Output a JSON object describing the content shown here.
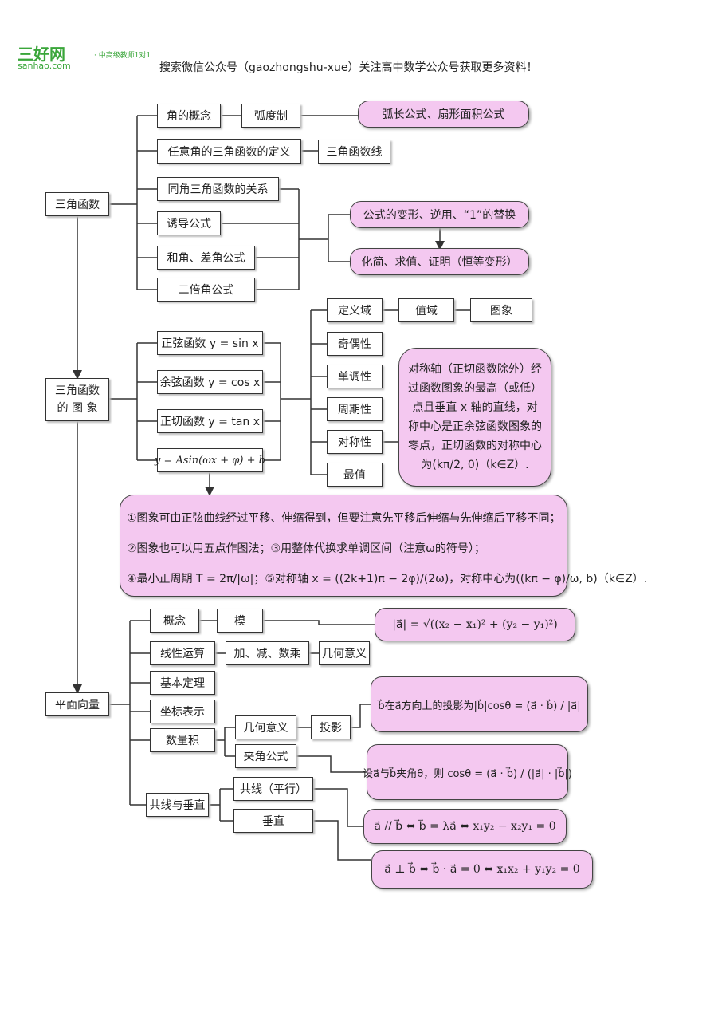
{
  "logo": {
    "brand": "三好网",
    "domain": "sanhao.com",
    "tagline": "· 中高级教师1对1"
  },
  "header": {
    "text": "搜索微信公众号（gaozhongshu-xue）关注高中数学公众号获取更多资料！"
  },
  "colors": {
    "highlight": "#f4c8f0",
    "line": "#333333",
    "logo": "#3aa63a"
  },
  "trig": {
    "root": "三角函数",
    "angle_concept": "角的概念",
    "radian": "弧度制",
    "arc_formula": "弧长公式、扇形面积公式",
    "any_angle_def": "任意角的三角函数的定义",
    "trig_line": "三角函数线",
    "same_angle": "同角三角函数的关系",
    "induction": "诱导公式",
    "sum_diff": "和角、差角公式",
    "double_angle": "二倍角公式",
    "transform": "公式的变形、逆用、“1”的替换",
    "simplify": "化简、求值、证明（恒等变形）"
  },
  "graph": {
    "root": "三角函数的 图 象",
    "sin": "正弦函数 y = sin x",
    "cos": "余弦函数 y = cos x",
    "tan": "正切函数 y = tan x",
    "general": "y = Asin(ωx + φ) + b",
    "domain": "定义域",
    "range": "值域",
    "image": "图象",
    "parity": "奇偶性",
    "monotonic": "单调性",
    "period": "周期性",
    "symmetry": "对称性",
    "extreme": "最值",
    "symmetry_note": "对称轴（正切函数除外）经过函数图象的最高（或低）点且垂直 x 轴的直线，对称中心是正余弦函数图象的零点，正切函数的对称中心为(kπ/2, 0)（k∈Z）.",
    "notes": [
      "①图象可由正弦曲线经过平移、伸缩得到，但要注意先平移后伸缩与先伸缩后平移不同；",
      "②图象也可以用五点作图法；③用整体代换求单调区间（注意ω的符号）；",
      "④最小正周期 T = 2π/|ω|；⑤对称轴 x = ((2k+1)π − 2φ)/(2ω)，对称中心为((kπ − φ)/ω, b)（k∈Z）."
    ]
  },
  "vector": {
    "root": "平面向量",
    "concept": "概念",
    "modulus": "模",
    "modulus_formula": "|a⃗| = √((x₂ − x₁)² + (y₂ − y₁)²)",
    "linear": "线性运算",
    "add_sub_mul": "加、减、数乘",
    "geo_meaning1": "几何意义",
    "basic_theorem": "基本定理",
    "coordinates": "坐标表示",
    "dot_product": "数量积",
    "geo_meaning2": "几何意义",
    "projection": "投影",
    "projection_formula": "b⃗在a⃗方向上的投影为|b⃗|cosθ = (a⃗ · b⃗) / |a⃗|",
    "angle_formula": "夹角公式",
    "angle_formula_text": "设a⃗与b⃗夹角θ，则 cosθ = (a⃗ · b⃗) / (|a⃗| · |b⃗|)",
    "collinear_perp": "共线与垂直",
    "collinear": "共线（平行）",
    "collinear_formula": "a⃗ // b⃗ ⇔ b⃗ = λa⃗ ⇔ x₁y₂ − x₂y₁ = 0",
    "perpendicular": "垂直",
    "perp_formula": "a⃗ ⊥ b⃗ ⇔ b⃗ · a⃗ = 0 ⇔ x₁x₂ + y₁y₂ = 0"
  }
}
